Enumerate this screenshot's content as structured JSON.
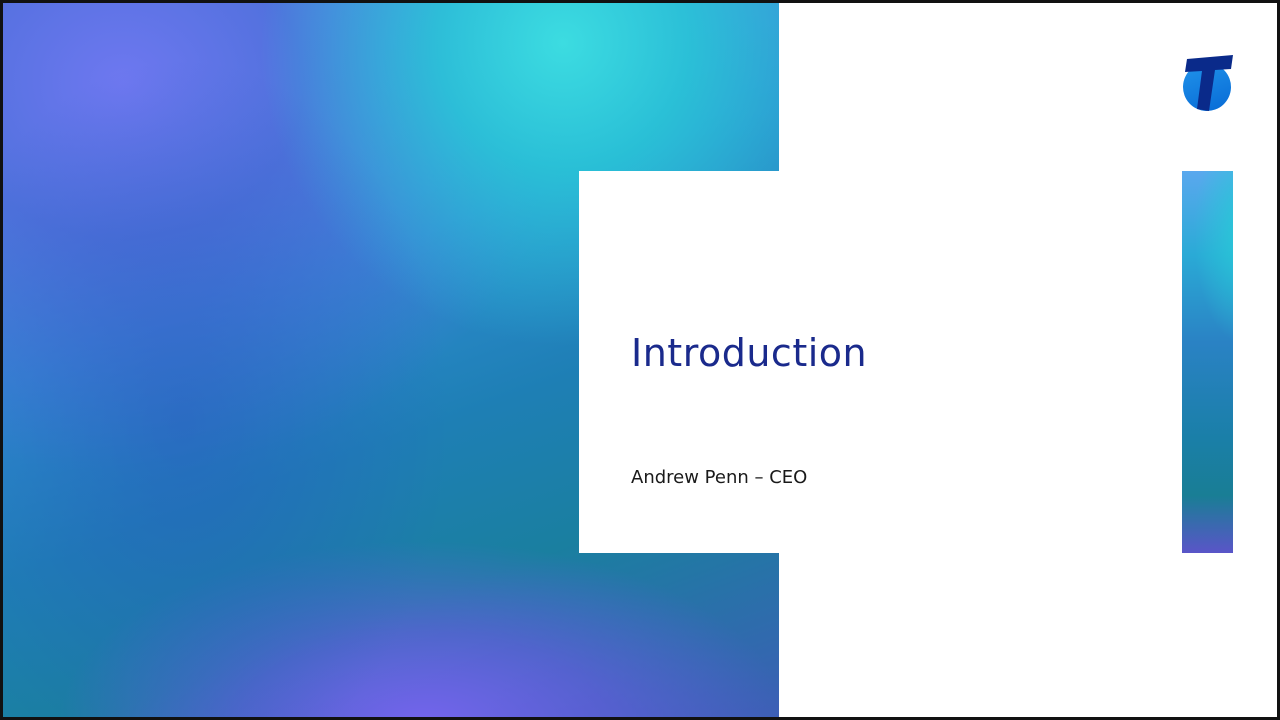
{
  "slide": {
    "title": "Introduction",
    "subtitle": "Andrew Penn – CEO"
  },
  "colors": {
    "title": "#1a2a8c",
    "logo": "#0d7fe0",
    "logo_dark": "#0a2a8a"
  },
  "icons": {
    "logo": "telstra-logo-icon"
  }
}
